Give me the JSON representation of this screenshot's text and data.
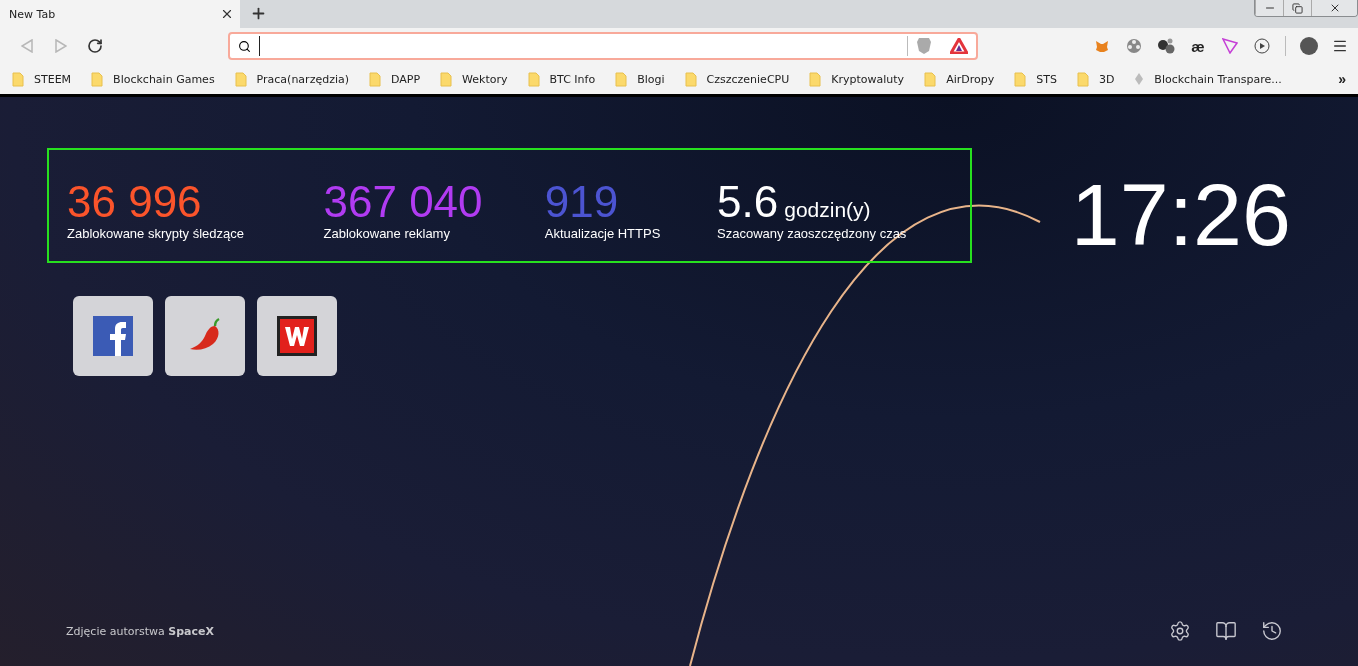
{
  "tabs": [
    {
      "label": "New Tab",
      "selected": true
    }
  ],
  "toolbar": {
    "back_disabled": true,
    "forward_disabled": true,
    "address": {
      "focused": true
    },
    "extensions": [
      {
        "kind": "fox"
      },
      {
        "kind": "reel"
      },
      {
        "kind": "balls"
      },
      {
        "kind": "text",
        "label": "æ"
      },
      {
        "kind": "triangle"
      },
      {
        "kind": "play"
      }
    ]
  },
  "bookmarks": [
    {
      "kind": "folder",
      "label": "STEEM"
    },
    {
      "kind": "folder",
      "label": "Blockchain Games"
    },
    {
      "kind": "folder",
      "label": "Praca(narzędzia)"
    },
    {
      "kind": "folder",
      "label": "DAPP"
    },
    {
      "kind": "folder",
      "label": "Wektory"
    },
    {
      "kind": "folder",
      "label": "BTC Info"
    },
    {
      "kind": "folder",
      "label": "Blogi"
    },
    {
      "kind": "folder",
      "label": "CzszczenieCPU"
    },
    {
      "kind": "folder",
      "label": "Kryptowaluty"
    },
    {
      "kind": "folder",
      "label": "AirDropy"
    },
    {
      "kind": "folder",
      "label": "STS"
    },
    {
      "kind": "folder",
      "label": "3D"
    },
    {
      "kind": "page",
      "label": "Blockchain Transpare..."
    }
  ],
  "more_bookmarks": "»",
  "stats": [
    {
      "value": "36 996",
      "label": "Zablokowane skrypty śledzące",
      "color": "#fb542b"
    },
    {
      "value": "367 040",
      "label": "Zablokowane reklamy",
      "color": "#b13bf2"
    },
    {
      "value": "919",
      "label": "Aktualizacje HTTPS",
      "color": "#4c54d2"
    },
    {
      "value": "5.6",
      "unit": "godzin(y)",
      "label": "Szacowany zaoszczędzony czas",
      "color": "#ffffff"
    }
  ],
  "clock": "17:26",
  "top_sites": [
    {
      "kind": "facebook"
    },
    {
      "kind": "pepper"
    },
    {
      "kind": "wykop"
    }
  ],
  "credit": "Zdjęcie autorstwa **SpaceX**",
  "footer_icons": [
    {
      "kind": "settings"
    },
    {
      "kind": "bookmarks"
    },
    {
      "kind": "history"
    }
  ]
}
